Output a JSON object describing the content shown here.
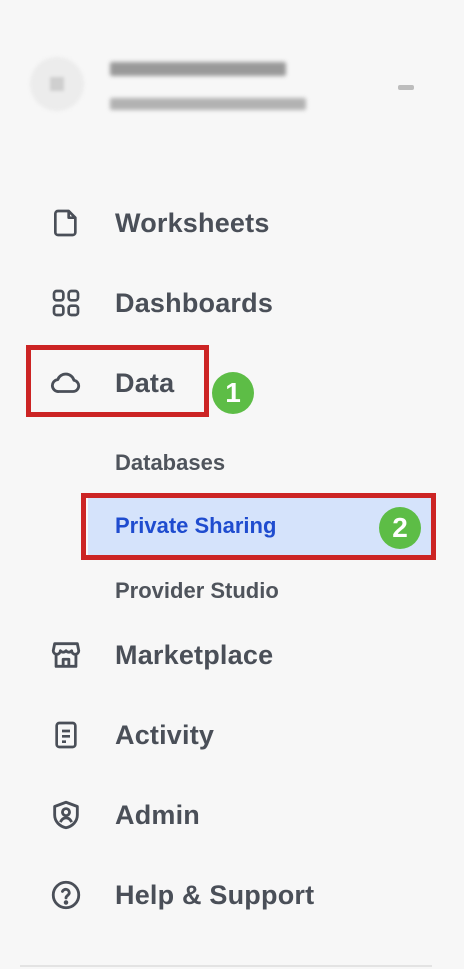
{
  "nav": {
    "items": [
      {
        "label": "Worksheets",
        "icon": "file-icon"
      },
      {
        "label": "Dashboards",
        "icon": "grid-icon"
      },
      {
        "label": "Data",
        "icon": "cloud-icon"
      },
      {
        "label": "Marketplace",
        "icon": "storefront-icon"
      },
      {
        "label": "Activity",
        "icon": "clipboard-list-icon"
      },
      {
        "label": "Admin",
        "icon": "shield-user-icon"
      },
      {
        "label": "Help & Support",
        "icon": "help-circle-icon"
      }
    ],
    "data_sub_items": [
      {
        "label": "Databases"
      },
      {
        "label": "Private Sharing",
        "active": true
      },
      {
        "label": "Provider Studio"
      }
    ]
  },
  "annotations": [
    {
      "label": "1",
      "color": "#5dbd46"
    },
    {
      "label": "2",
      "color": "#5dbd46"
    }
  ],
  "colors": {
    "accent_text": "#1f4ccf",
    "active_bg": "#d5e3fb",
    "annotation_border": "#cc2424"
  }
}
